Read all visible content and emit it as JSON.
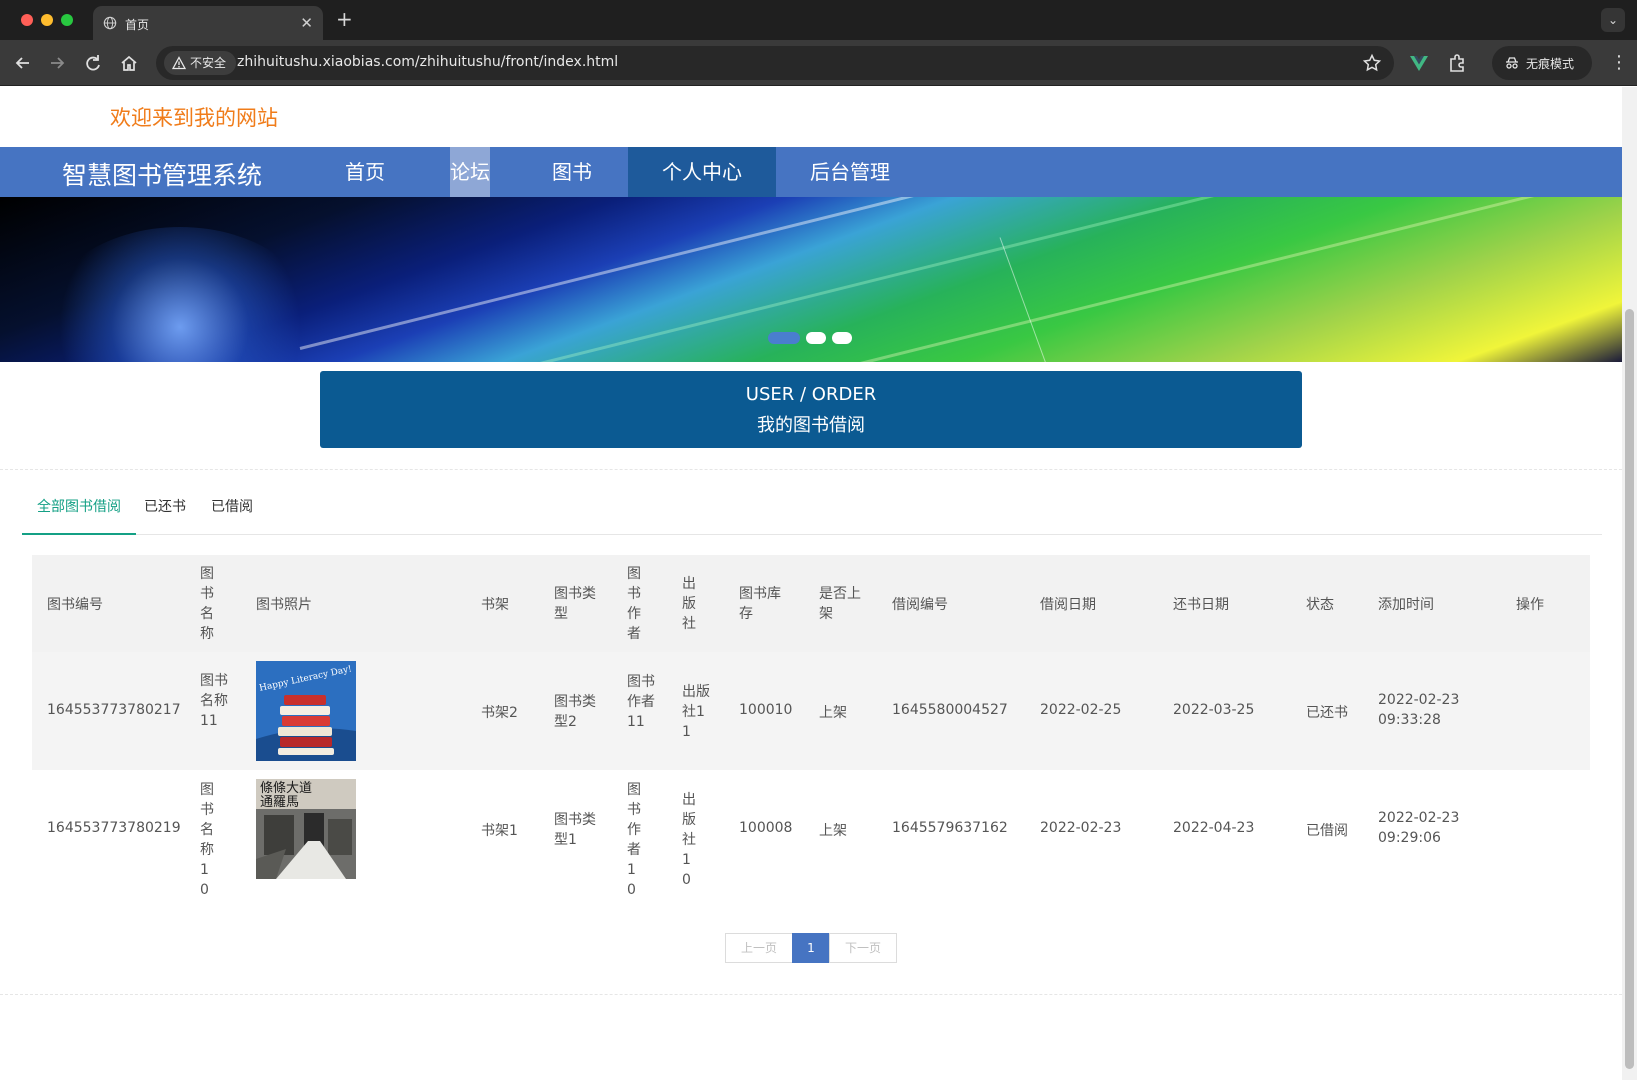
{
  "browser": {
    "tab_title": "首页",
    "security_label": "不安全",
    "url": "zhihuitushu.xiaobias.com/zhihuitushu/front/index.html",
    "incognito_label": "无痕模式"
  },
  "header": {
    "welcome": "欢迎来到我的网站",
    "brand": "智慧图书管理系统",
    "nav": [
      "首页",
      "论坛",
      "图书",
      "个人中心",
      "后台管理"
    ],
    "active_nav": "个人中心"
  },
  "banner": {
    "slide_count": 3,
    "active_slide": 1
  },
  "section": {
    "title_en": "USER / ORDER",
    "title_cn": "我的图书借阅"
  },
  "tabs": [
    "全部图书借阅",
    "已还书",
    "已借阅"
  ],
  "active_tab": "全部图书借阅",
  "table": {
    "headers": [
      "图书编号",
      "图书名称",
      "图书照片",
      "书架",
      "图书类型",
      "图书作者",
      "出版社",
      "图书库存",
      "是否上架",
      "借阅编号",
      "借阅日期",
      "还书日期",
      "状态",
      "添加时间",
      "操作"
    ],
    "rows": [
      {
        "book_id": "164553773780217",
        "name": "图书名称11",
        "cover": "book-stack-cover",
        "shelf": "书架2",
        "type": "图书类型2",
        "author": "图书作者11",
        "publisher": "出版社11",
        "stock": "100010",
        "listed": "上架",
        "borrow_id": "1645580004527",
        "borrow_date": "2022-02-25",
        "return_date": "2022-03-25",
        "status": "已还书",
        "add_date": "2022-02-23",
        "add_time": "09:33:28"
      },
      {
        "book_id": "164553773780219",
        "name": "图书名称10",
        "cover": "rome-road-cover",
        "shelf": "书架1",
        "type": "图书类型1",
        "author": "图书作者10",
        "publisher": "出版社10",
        "stock": "100008",
        "listed": "上架",
        "borrow_id": "1645579637162",
        "borrow_date": "2022-02-23",
        "return_date": "2022-04-23",
        "status": "已借阅",
        "add_date": "2022-02-23",
        "add_time": "09:29:06"
      }
    ]
  },
  "pagination": {
    "prev": "上一页",
    "current": "1",
    "next": "下一页"
  },
  "colors": {
    "nav_bg": "#4674c2",
    "nav_active": "#1e5a9b",
    "section_bg": "#0b5a92",
    "welcome_text": "#f07c1a",
    "tab_active": "#14a085"
  }
}
